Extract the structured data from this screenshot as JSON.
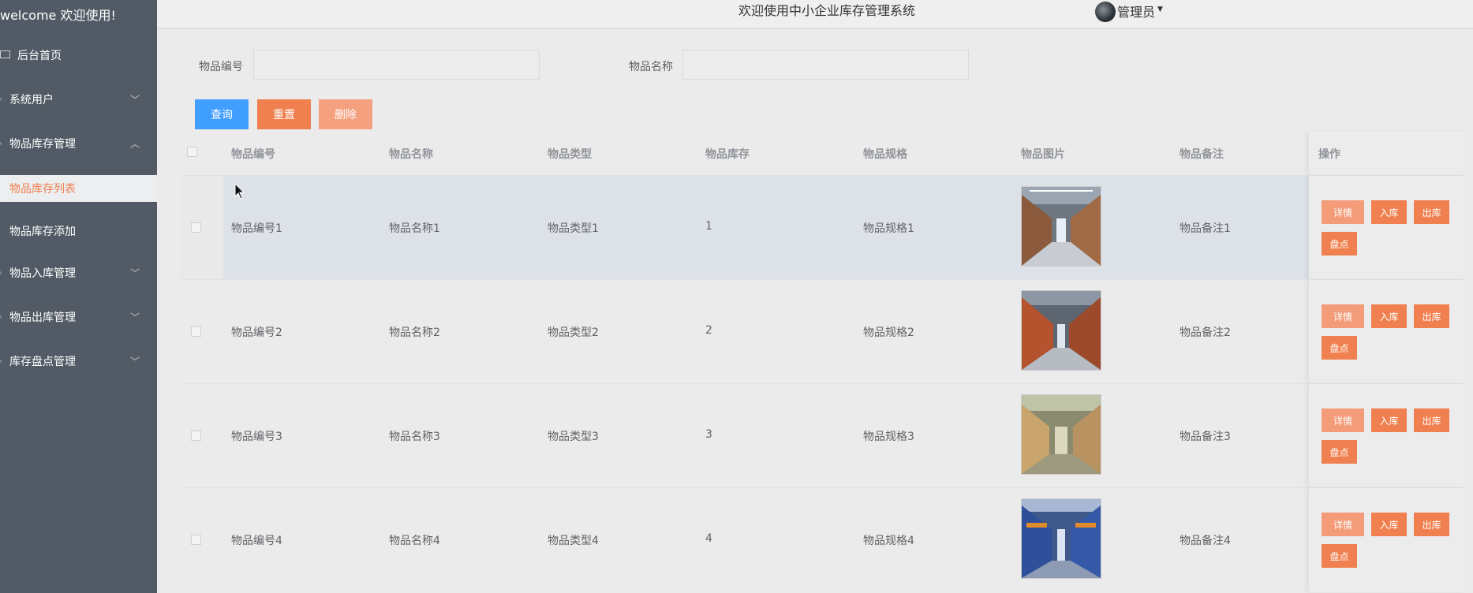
{
  "sidebar": {
    "welcome": "welcome 欢迎使用!",
    "items": [
      {
        "label": "后台首页"
      },
      {
        "label": "系统用户"
      },
      {
        "label": "物品库存管理"
      },
      {
        "label": "物品库存列表"
      },
      {
        "label": "物品库存添加"
      },
      {
        "label": "物品入库管理"
      },
      {
        "label": "物品出库管理"
      },
      {
        "label": "库存盘点管理"
      }
    ]
  },
  "header": {
    "title": "欢迎使用中小企业库存管理系统",
    "user": "管理员"
  },
  "search": {
    "code_label": "物品编号",
    "code_value": "",
    "name_label": "物品名称",
    "name_value": "",
    "query_label": "查询",
    "reset_label": "重置",
    "delete_label": "删除"
  },
  "table": {
    "columns": [
      "物品编号",
      "物品名称",
      "物品类型",
      "物品库存",
      "物品规格",
      "物品图片",
      "物品备注",
      "操作"
    ],
    "rows": [
      {
        "code": "物品编号1",
        "name": "物品名称1",
        "type": "物品类型1",
        "stock": "1",
        "spec": "物品规格1",
        "remark": "物品备注1"
      },
      {
        "code": "物品编号2",
        "name": "物品名称2",
        "type": "物品类型2",
        "stock": "2",
        "spec": "物品规格2",
        "remark": "物品备注2"
      },
      {
        "code": "物品编号3",
        "name": "物品名称3",
        "type": "物品类型3",
        "stock": "3",
        "spec": "物品规格3",
        "remark": "物品备注3"
      },
      {
        "code": "物品编号4",
        "name": "物品名称4",
        "type": "物品类型4",
        "stock": "4",
        "spec": "物品规格4",
        "remark": "物品备注4"
      }
    ],
    "actions": {
      "detail": "详情",
      "in": "入库",
      "out": "出库",
      "check": "盘点"
    }
  },
  "colors": {
    "sidebar_bg": "#525b65",
    "accent_orange": "#f0804f",
    "primary_blue": "#409eff",
    "row_highlight": "#dde2e8"
  }
}
